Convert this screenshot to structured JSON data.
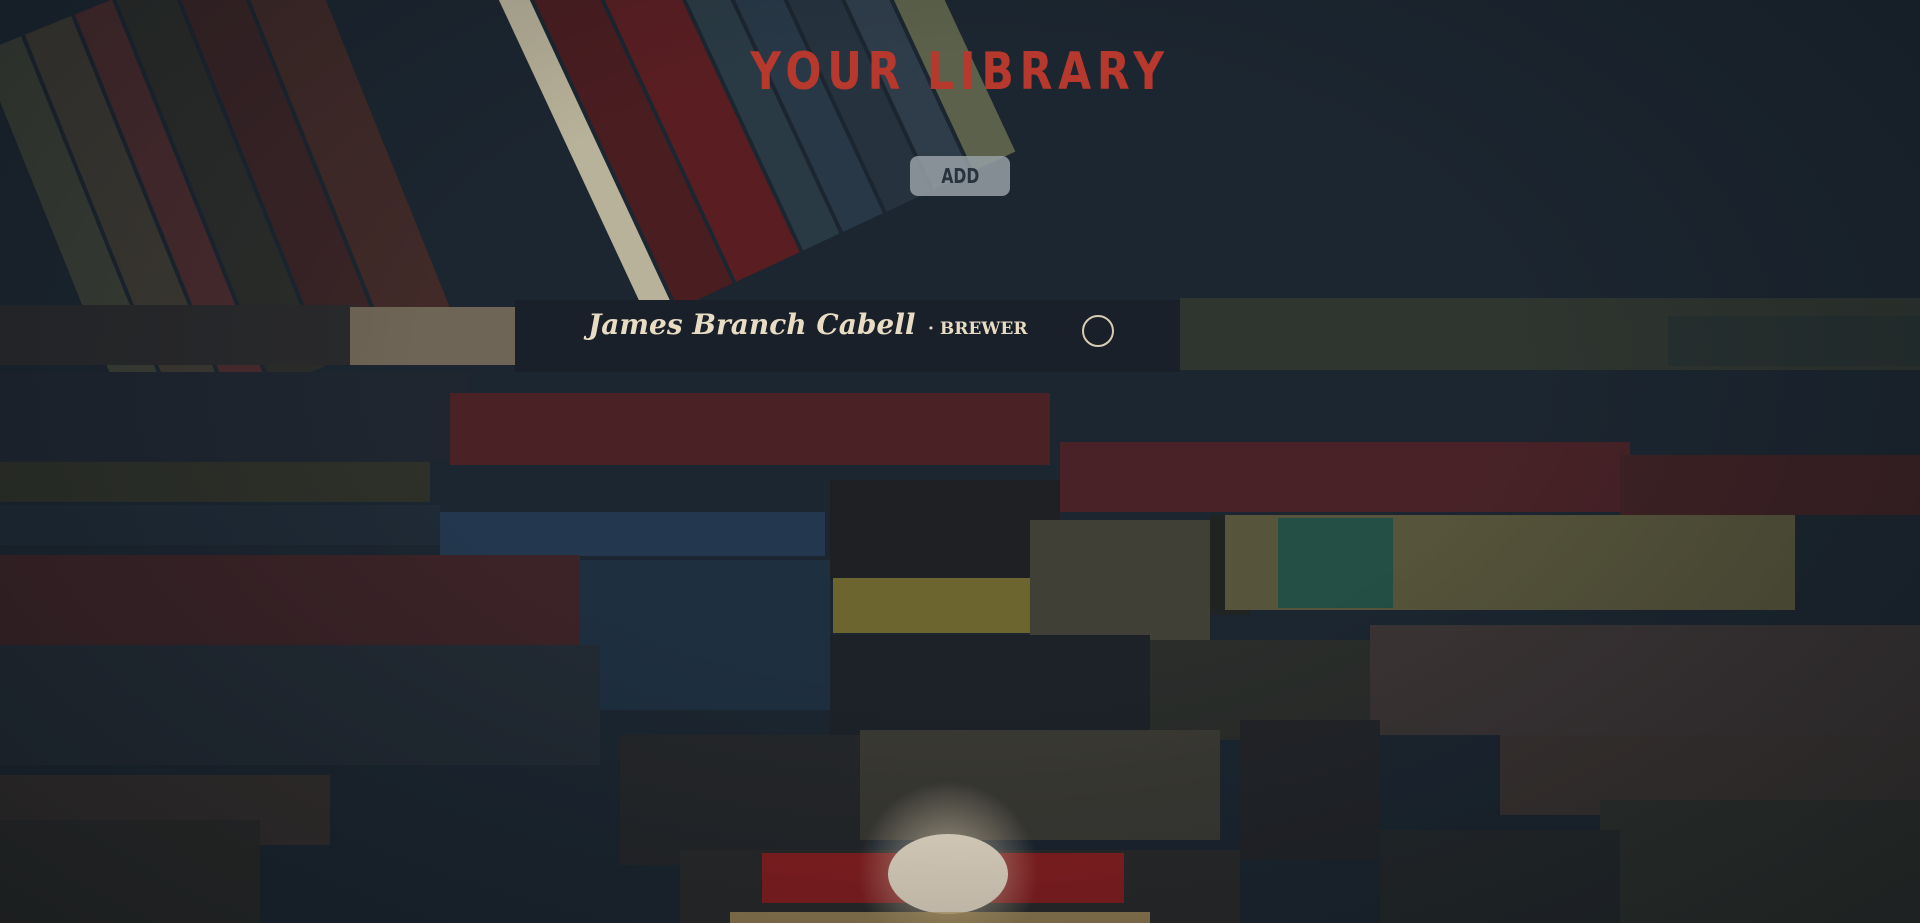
{
  "page": {
    "title": "YOUR LIBRARY",
    "add_button_label": "ADD"
  },
  "background": {
    "description_spine_text": "James Branch Cabell",
    "publisher_spine_text": "· BREWER"
  },
  "colors": {
    "title_accent": "#b7382d",
    "button_bg": "#969fa4",
    "button_text": "#273440",
    "background": "#1c2630"
  }
}
